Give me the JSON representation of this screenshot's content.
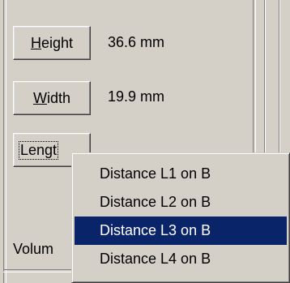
{
  "dimensions": {
    "height_button": {
      "label_mnemonic": "H",
      "label_rest": "eight",
      "value": "36.6 mm"
    },
    "width_button": {
      "label_mnemonic": "W",
      "label_rest": "idth",
      "value": "19.9 mm"
    },
    "length_button": {
      "label_visible": "Lengt"
    },
    "volume_label": "Volum"
  },
  "context_menu": {
    "items": [
      {
        "label": "Distance L1 on B",
        "selected": false
      },
      {
        "label": "Distance L2 on B",
        "selected": false
      },
      {
        "label": "Distance L3 on B",
        "selected": true
      },
      {
        "label": "Distance L4 on B",
        "selected": false
      }
    ],
    "selected_bg": "#0a246a",
    "selected_fg": "#ffffff"
  },
  "colors": {
    "face": "#d4d0c8",
    "highlight": "#ffffff",
    "shadow": "#808080",
    "dark_shadow": "#404040"
  }
}
